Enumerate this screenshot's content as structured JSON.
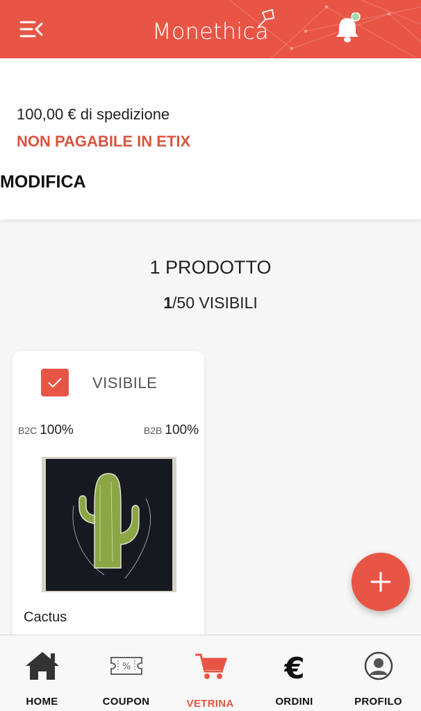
{
  "header": {
    "brand": "Monethica",
    "colors": {
      "accent": "#e85545",
      "text": "#ffffff"
    }
  },
  "store_info": {
    "shipping_text": "100,00 € di spedizione",
    "payment_notice": "NON PAGABILE IN ETIX",
    "edit_label": "MODIFICA"
  },
  "summary": {
    "products_count": "1 PRODOTTO",
    "visible_num": "1",
    "visible_rest": "/50 VISIBILI"
  },
  "product": {
    "visibility_label": "VISIBILE",
    "visible_checked": true,
    "b2c_tag": "B2C",
    "b2c_value": "100%",
    "b2b_tag": "B2B",
    "b2b_value": "100%",
    "name": "Cactus"
  },
  "nav": {
    "items": [
      {
        "label": "HOME",
        "icon": "home-icon"
      },
      {
        "label": "COUPON",
        "icon": "coupon-icon"
      },
      {
        "label": "VETRINA",
        "icon": "cart-icon",
        "active": true
      },
      {
        "label": "ORDINI",
        "icon": "euro-icon"
      },
      {
        "label": "PROFILO",
        "icon": "user-icon"
      }
    ]
  }
}
